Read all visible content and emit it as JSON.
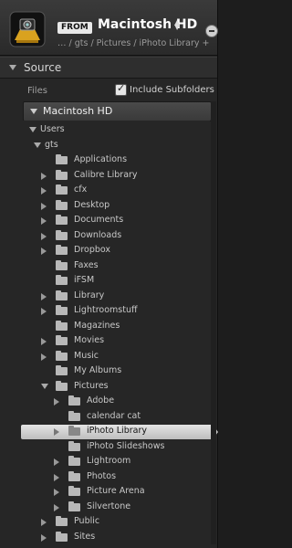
{
  "header": {
    "from_badge": "FROM",
    "volume_name": "Macintosh HD",
    "breadcrumb": "… / gts / Pictures / iPhoto Library +",
    "app_icon": "import-camera-icon",
    "panel_button_icon": "minus-circle-icon"
  },
  "source": {
    "title": "Source",
    "files_label": "Files",
    "include_subfolders": {
      "label": "Include Subfolders",
      "checked": true
    },
    "volume": "Macintosh HD"
  },
  "tree": [
    {
      "label": "Users",
      "depth": 0,
      "disclosure": "open",
      "folder": false
    },
    {
      "label": "gts",
      "depth": 1,
      "disclosure": "open",
      "folder": false
    },
    {
      "label": "Applications",
      "depth": 2,
      "disclosure": "none",
      "folder": true
    },
    {
      "label": "Calibre Library",
      "depth": 2,
      "disclosure": "closed",
      "folder": true
    },
    {
      "label": "cfx",
      "depth": 2,
      "disclosure": "closed",
      "folder": true
    },
    {
      "label": "Desktop",
      "depth": 2,
      "disclosure": "closed",
      "folder": true
    },
    {
      "label": "Documents",
      "depth": 2,
      "disclosure": "closed",
      "folder": true
    },
    {
      "label": "Downloads",
      "depth": 2,
      "disclosure": "closed",
      "folder": true
    },
    {
      "label": "Dropbox",
      "depth": 2,
      "disclosure": "closed",
      "folder": true
    },
    {
      "label": "Faxes",
      "depth": 2,
      "disclosure": "none",
      "folder": true
    },
    {
      "label": "iFSM",
      "depth": 2,
      "disclosure": "none",
      "folder": true
    },
    {
      "label": "Library",
      "depth": 2,
      "disclosure": "closed",
      "folder": true
    },
    {
      "label": "Lightroomstuff",
      "depth": 2,
      "disclosure": "closed",
      "folder": true
    },
    {
      "label": "Magazines",
      "depth": 2,
      "disclosure": "none",
      "folder": true
    },
    {
      "label": "Movies",
      "depth": 2,
      "disclosure": "closed",
      "folder": true
    },
    {
      "label": "Music",
      "depth": 2,
      "disclosure": "closed",
      "folder": true
    },
    {
      "label": "My Albums",
      "depth": 2,
      "disclosure": "none",
      "folder": true
    },
    {
      "label": "Pictures",
      "depth": 2,
      "disclosure": "open",
      "folder": true
    },
    {
      "label": "Adobe",
      "depth": 3,
      "disclosure": "closed",
      "folder": true
    },
    {
      "label": "calendar cat",
      "depth": 3,
      "disclosure": "none",
      "folder": true
    },
    {
      "label": "iPhoto Library",
      "depth": 3,
      "disclosure": "closed",
      "folder": true,
      "selected": true
    },
    {
      "label": "iPhoto Slideshows",
      "depth": 3,
      "disclosure": "none",
      "folder": true
    },
    {
      "label": "Lightroom",
      "depth": 3,
      "disclosure": "closed",
      "folder": true
    },
    {
      "label": "Photos",
      "depth": 3,
      "disclosure": "closed",
      "folder": true
    },
    {
      "label": "Picture Arena",
      "depth": 3,
      "disclosure": "closed",
      "folder": true
    },
    {
      "label": "Silvertone",
      "depth": 3,
      "disclosure": "closed",
      "folder": true
    },
    {
      "label": "Public",
      "depth": 2,
      "disclosure": "closed",
      "folder": true
    },
    {
      "label": "Sites",
      "depth": 2,
      "disclosure": "closed",
      "folder": true
    }
  ]
}
